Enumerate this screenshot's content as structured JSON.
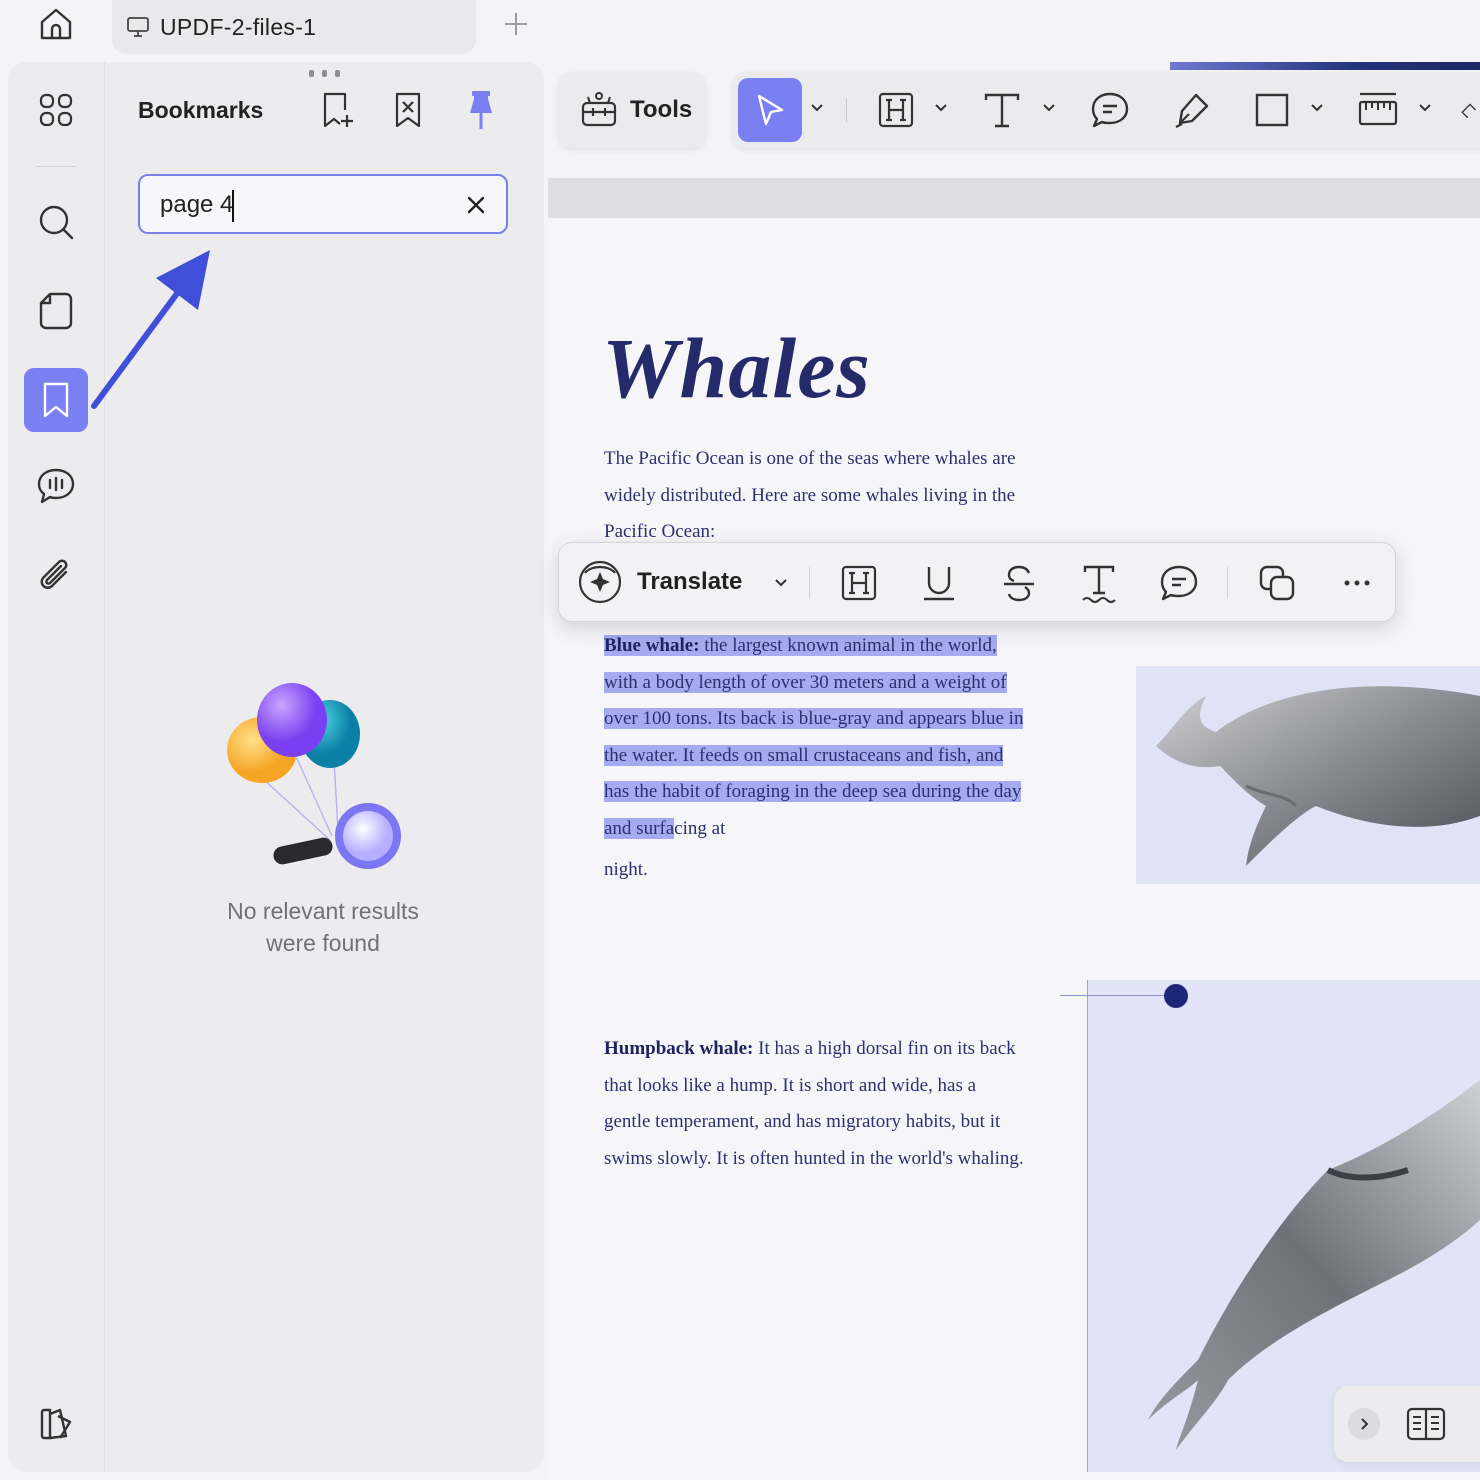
{
  "tab": {
    "title": "UPDF-2-files-1",
    "icons": [
      "home-icon",
      "monitor-icon",
      "plus-icon"
    ]
  },
  "rail": {
    "icons": [
      "thumbnails-icon",
      "search-icon",
      "page-icon",
      "bookmark-icon",
      "comment-icon",
      "attachment-icon",
      "layers-icon"
    ],
    "active": "bookmark-icon"
  },
  "bookmarks": {
    "title": "Bookmarks",
    "search_value": "page 4",
    "empty_message_line1": "No relevant results",
    "empty_message_line2": "were found"
  },
  "toolbar": {
    "tools_label": "Tools",
    "icons": [
      "select-icon",
      "highlight-icon",
      "text-icon",
      "comment-icon",
      "pen-icon",
      "rectangle-icon",
      "measure-icon"
    ]
  },
  "float_toolbar": {
    "translate_label": "Translate",
    "icons": [
      "highlight-icon",
      "underline-icon",
      "strikethrough-icon",
      "squiggly-icon",
      "comment-icon",
      "copy-icon",
      "more-icon"
    ]
  },
  "document": {
    "title": "Whales",
    "intro": "The Pacific Ocean is one of the seas where whales are widely distributed. Here are some whales living in the Pacific Ocean:",
    "blue_term": "Blue whale:",
    "blue_selected": "the largest known animal in the world, with a body length of over 30 meters and a weight of over 100 tons. Its back is blue-gray and appears blue in the water. It feeds on small crustaceans and fish, and has the habit of foraging in the deep sea during the day and surfa",
    "blue_rest": "cing at",
    "blue_end": "night.",
    "hump_term": "Humpback whale:",
    "hump_text": "It has a high dorsal fin on its back that looks like a hump. It is short and wide, has a gentle temperament, and has migratory habits, but it swims slowly. It is often hunted in the world's whaling."
  },
  "colors": {
    "accent": "#7a7ff2",
    "selection": "#a6aaf0",
    "doc_text": "#2d3070",
    "title": "#252a6a"
  }
}
